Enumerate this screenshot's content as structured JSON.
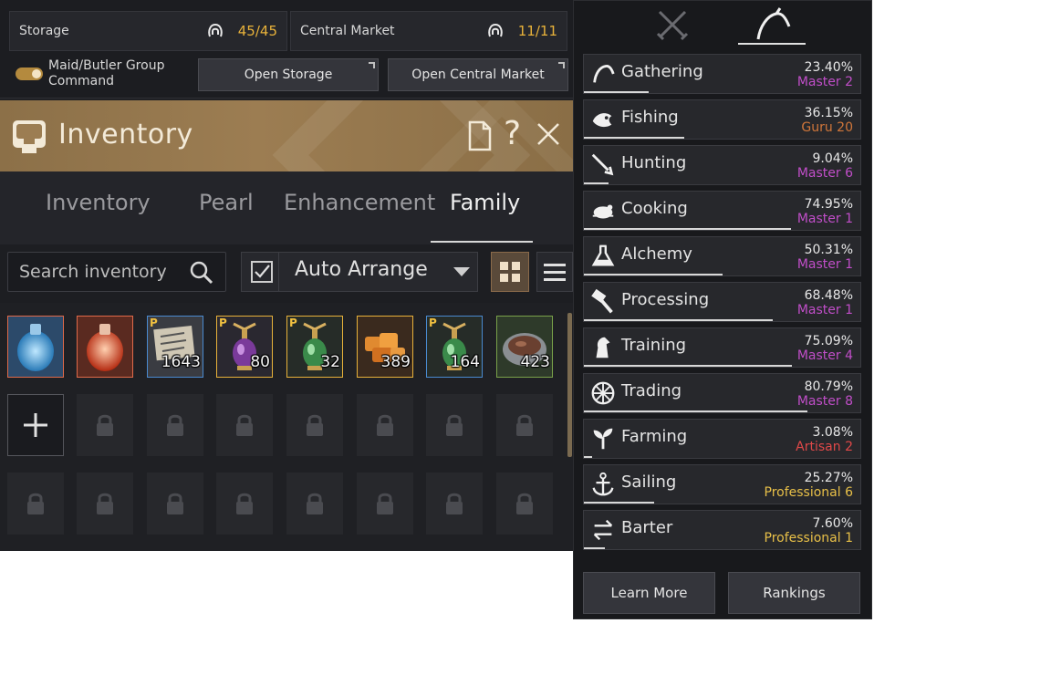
{
  "storage_bar": {
    "storage": {
      "label": "Storage",
      "value": "45/45"
    },
    "central_market": {
      "label": "Central Market",
      "value": "11/11"
    },
    "maid_toggle": {
      "label": "Maid/Butler Group Command",
      "on": true
    },
    "open_storage_label": "Open Storage",
    "open_market_label": "Open Central Market"
  },
  "inventory": {
    "title": "Inventory",
    "help": "?",
    "tabs": [
      {
        "label": "Inventory",
        "active": false
      },
      {
        "label": "Pearl",
        "active": false
      },
      {
        "label": "Enhancement",
        "active": false
      },
      {
        "label": "Family",
        "active": true
      }
    ],
    "search": {
      "placeholder": "Search inventory",
      "value": ""
    },
    "auto_arrange": {
      "label": "Auto Arrange",
      "checked": true
    },
    "items": [
      {
        "name": "blue-potion",
        "qty": "",
        "premium": false,
        "border": "#e06a4a",
        "icon": "potion-blue"
      },
      {
        "name": "red-potion",
        "qty": "",
        "premium": false,
        "border": "#e06a4a",
        "icon": "potion-red"
      },
      {
        "name": "map-scroll",
        "qty": "1643",
        "premium": true,
        "border": "#4a8ad0",
        "icon": "scroll"
      },
      {
        "name": "purple-elixir",
        "qty": "80",
        "premium": true,
        "border": "#e8b23a",
        "icon": "elixir-purple"
      },
      {
        "name": "green-elixir",
        "qty": "32",
        "premium": true,
        "border": "#e8b23a",
        "icon": "elixir-green"
      },
      {
        "name": "food-platter",
        "qty": "389",
        "premium": false,
        "border": "#e8b23a",
        "icon": "food"
      },
      {
        "name": "green-elixir-2",
        "qty": "164",
        "premium": true,
        "border": "#4a8ad0",
        "icon": "elixir-green"
      },
      {
        "name": "stew-bowl",
        "qty": "423",
        "premium": false,
        "border": "#7aa24a",
        "icon": "bowl"
      }
    ]
  },
  "life_skills": {
    "tab_combat_icon": "crossed-swords-icon",
    "tab_life_icon": "sickle-icon",
    "skills": [
      {
        "name": "Gathering",
        "percent": "23.40%",
        "rank": "Master 2",
        "rank_color": "#c04ec8",
        "icon": "sickle-icon",
        "progress": 0.234
      },
      {
        "name": "Fishing",
        "percent": "36.15%",
        "rank": "Guru 20",
        "rank_color": "#d0763a",
        "icon": "fish-icon",
        "progress": 0.3615
      },
      {
        "name": "Hunting",
        "percent": "9.04%",
        "rank": "Master 6",
        "rank_color": "#c04ec8",
        "icon": "rifle-icon",
        "progress": 0.0904
      },
      {
        "name": "Cooking",
        "percent": "74.95%",
        "rank": "Master 1",
        "rank_color": "#c04ec8",
        "icon": "roast-icon",
        "progress": 0.7495
      },
      {
        "name": "Alchemy",
        "percent": "50.31%",
        "rank": "Master 1",
        "rank_color": "#c04ec8",
        "icon": "flask-icon",
        "progress": 0.5031
      },
      {
        "name": "Processing",
        "percent": "68.48%",
        "rank": "Master 1",
        "rank_color": "#c04ec8",
        "icon": "hammer-icon",
        "progress": 0.6848
      },
      {
        "name": "Training",
        "percent": "75.09%",
        "rank": "Master 4",
        "rank_color": "#c04ec8",
        "icon": "horse-icon",
        "progress": 0.7509
      },
      {
        "name": "Trading",
        "percent": "80.79%",
        "rank": "Master 8",
        "rank_color": "#c04ec8",
        "icon": "wheel-icon",
        "progress": 0.8079
      },
      {
        "name": "Farming",
        "percent": "3.08%",
        "rank": "Artisan 2",
        "rank_color": "#e04848",
        "icon": "sprout-icon",
        "progress": 0.0308
      },
      {
        "name": "Sailing",
        "percent": "25.27%",
        "rank": "Professional 6",
        "rank_color": "#e8c048",
        "icon": "anchor-icon",
        "progress": 0.2527
      },
      {
        "name": "Barter",
        "percent": "7.60%",
        "rank": "Professional 1",
        "rank_color": "#e8c048",
        "icon": "exchange-icon",
        "progress": 0.076
      }
    ],
    "learn_more_label": "Learn More",
    "rankings_label": "Rankings"
  }
}
